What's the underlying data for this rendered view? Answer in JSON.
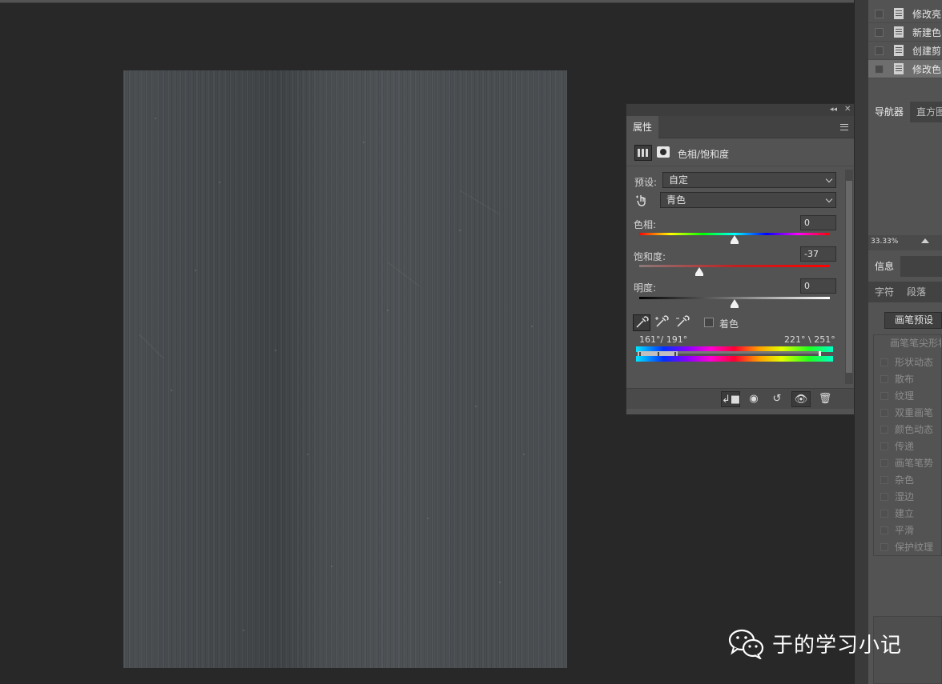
{
  "history": {
    "items": [
      {
        "label": "修改亮",
        "active": false
      },
      {
        "label": "新建色",
        "active": false
      },
      {
        "label": "创建剪",
        "active": false
      },
      {
        "label": "修改色",
        "active": true
      }
    ]
  },
  "navigator": {
    "tabs": [
      "导航器",
      "直方图"
    ],
    "zoom": "33.33%"
  },
  "info_panel": {
    "tabs": [
      "信息"
    ],
    "subtabs": [
      "字符",
      "段落"
    ]
  },
  "brush_panel": {
    "preset_button": "画笔预设",
    "tip_shape_label": "画笔笔尖形状",
    "options": [
      "形状动态",
      "散布",
      "纹理",
      "双重画笔",
      "颜色动态",
      "传递",
      "画笔笔势",
      "杂色",
      "湿边",
      "建立",
      "平滑",
      "保护纹理"
    ]
  },
  "properties": {
    "tab": "属性",
    "adjustment_title": "色相/饱和度",
    "preset_label": "预设:",
    "preset_value": "自定",
    "channel_value": "青色",
    "hue_label": "色相:",
    "hue_value": "0",
    "saturation_label": "饱和度:",
    "saturation_value": "-37",
    "lightness_label": "明度:",
    "lightness_value": "0",
    "colorize_label": "着色",
    "colorize_checked": false,
    "range_left": "161°/ 191°",
    "range_right": "221° \\ 251°",
    "hue_fraction": 0.5,
    "saturation_fraction": 0.315,
    "lightness_fraction": 0.5
  },
  "watermark": {
    "text": "于的学习小记"
  },
  "colors": {
    "panel": "#535353",
    "canvas_bg": "#282828",
    "document": "#4a4e51"
  }
}
